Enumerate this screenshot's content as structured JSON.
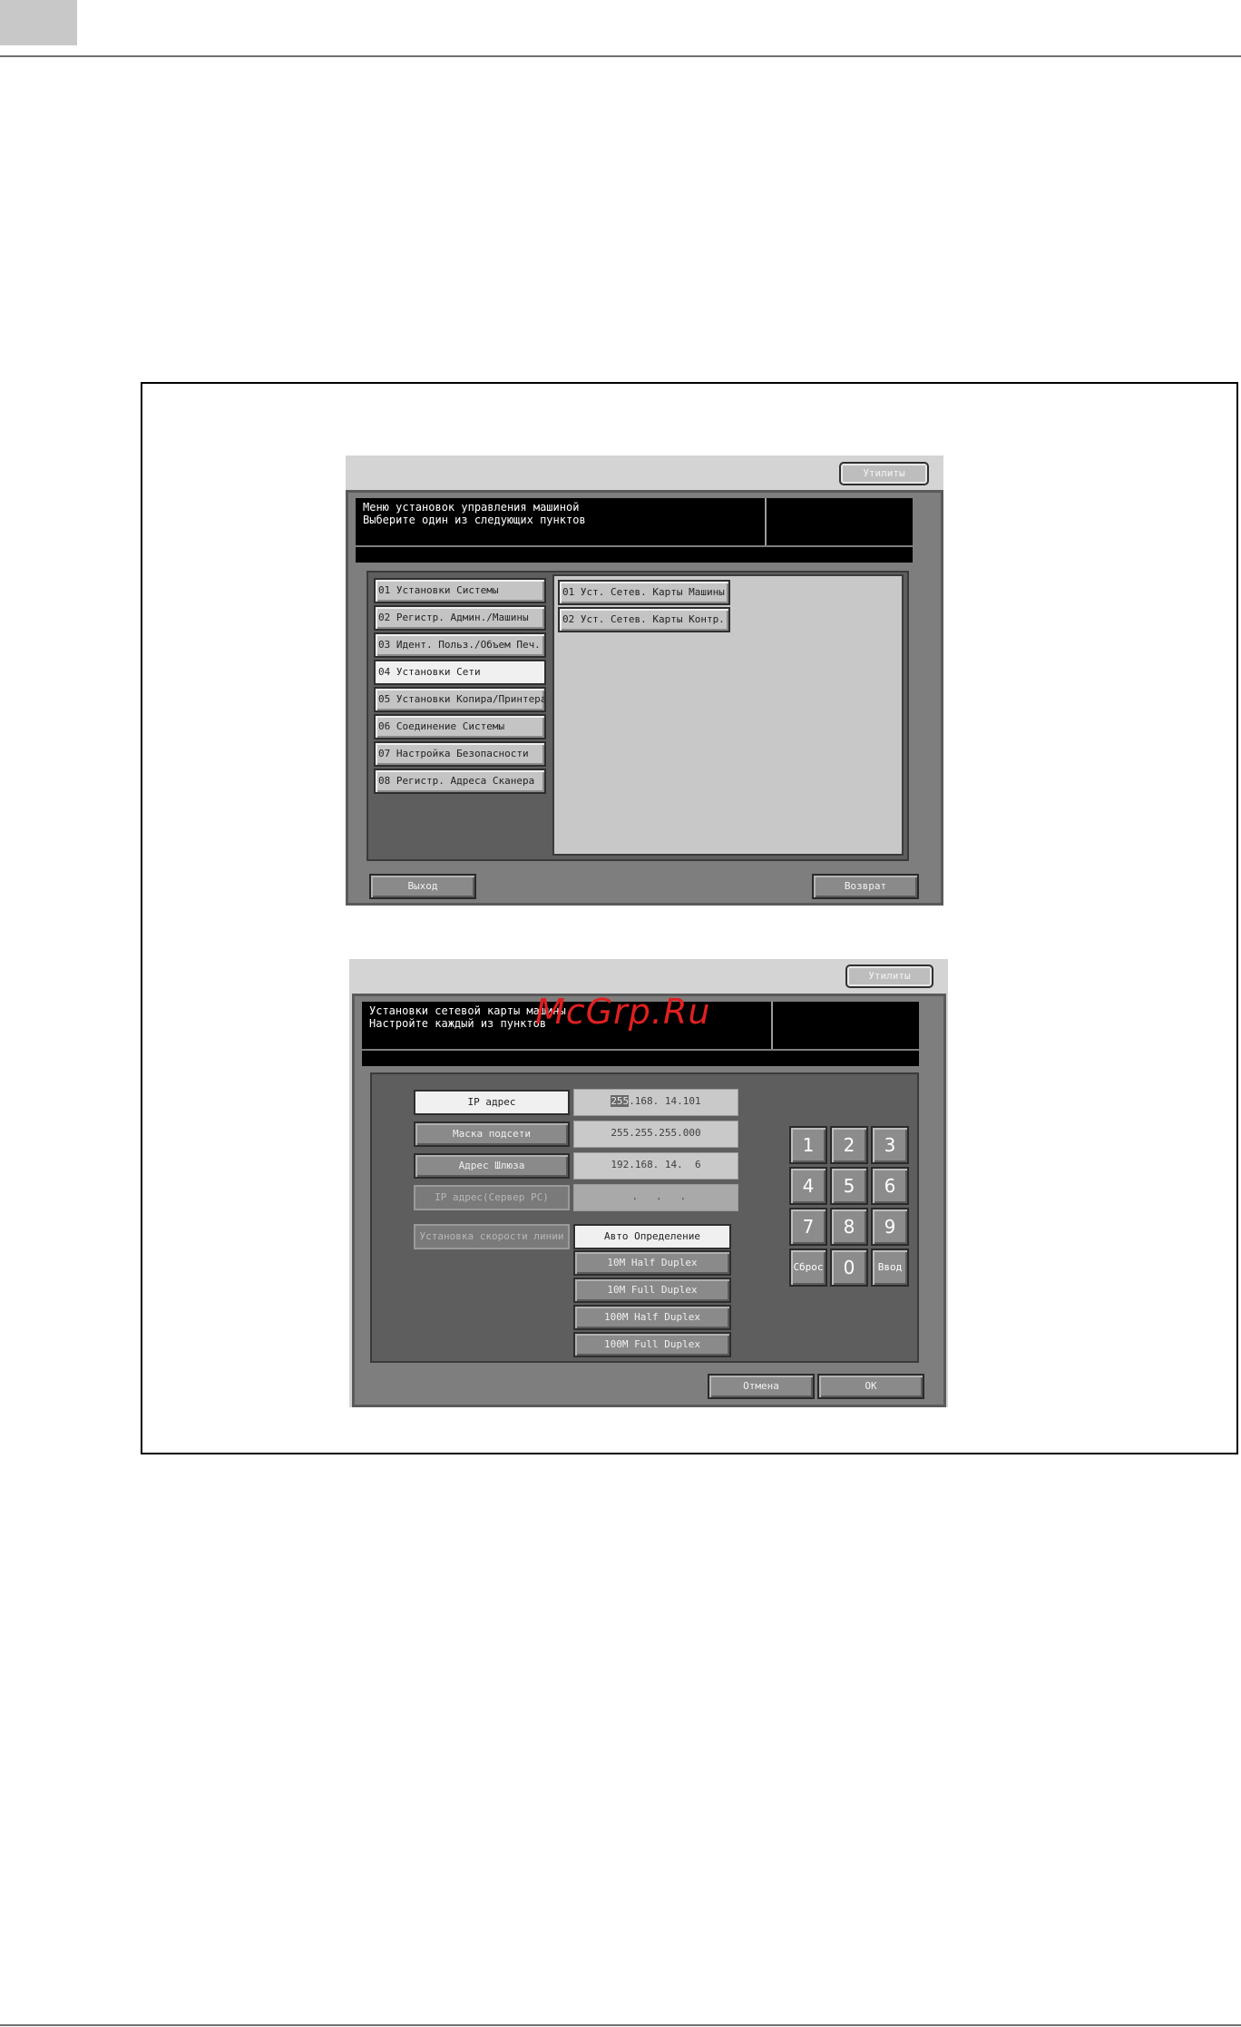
{
  "screen1": {
    "top_button": "Утилиты",
    "message": [
      "Меню установок управления машиной",
      "Выберите один из следующих пунктов"
    ],
    "menu": [
      "01 Установки Системы",
      "02 Регистр. Админ./Машины",
      "03 Идент. Польз./Объем Печ.",
      "04 Установки Сети",
      "05 Установки Копира/Принтера",
      "06 Соединение Системы",
      "07 Настройка Безопасности",
      "08 Регистр. Адреса Сканера"
    ],
    "selected_index": 3,
    "submenu": [
      "01 Уст. Сетев. Карты Машины",
      "02 Уст. Сетев. Карты Контр."
    ],
    "exit_button": "Выход",
    "return_button": "Возврат"
  },
  "screen2": {
    "top_button": "Утилиты",
    "message": [
      "Установки сетевой карты машины",
      "Настройте каждый из пунктов"
    ],
    "fields": [
      {
        "label": "IP адрес",
        "value_hl": "255",
        "value_rest": ".168. 14.101"
      },
      {
        "label": "Маска подсети",
        "value": "255.255.255.000"
      },
      {
        "label": "Адрес Шлюза",
        "value": "192.168. 14.  6"
      },
      {
        "label": "IP адрес(Сервер РС)",
        "value": " .   .   ."
      }
    ],
    "speed_label": "Установка скорости линии",
    "speed_options": [
      "Авто Определение",
      "10M Half Duplex",
      "10M Full Duplex",
      "100M Half Duplex",
      "100M Full Duplex"
    ],
    "keypad": [
      "1",
      "2",
      "3",
      "4",
      "5",
      "6",
      "7",
      "8",
      "9",
      "Сброс",
      "0",
      "Ввод"
    ],
    "cancel_button": "Отмена",
    "ok_button": "OK"
  },
  "watermark": "McGrp.Ru"
}
